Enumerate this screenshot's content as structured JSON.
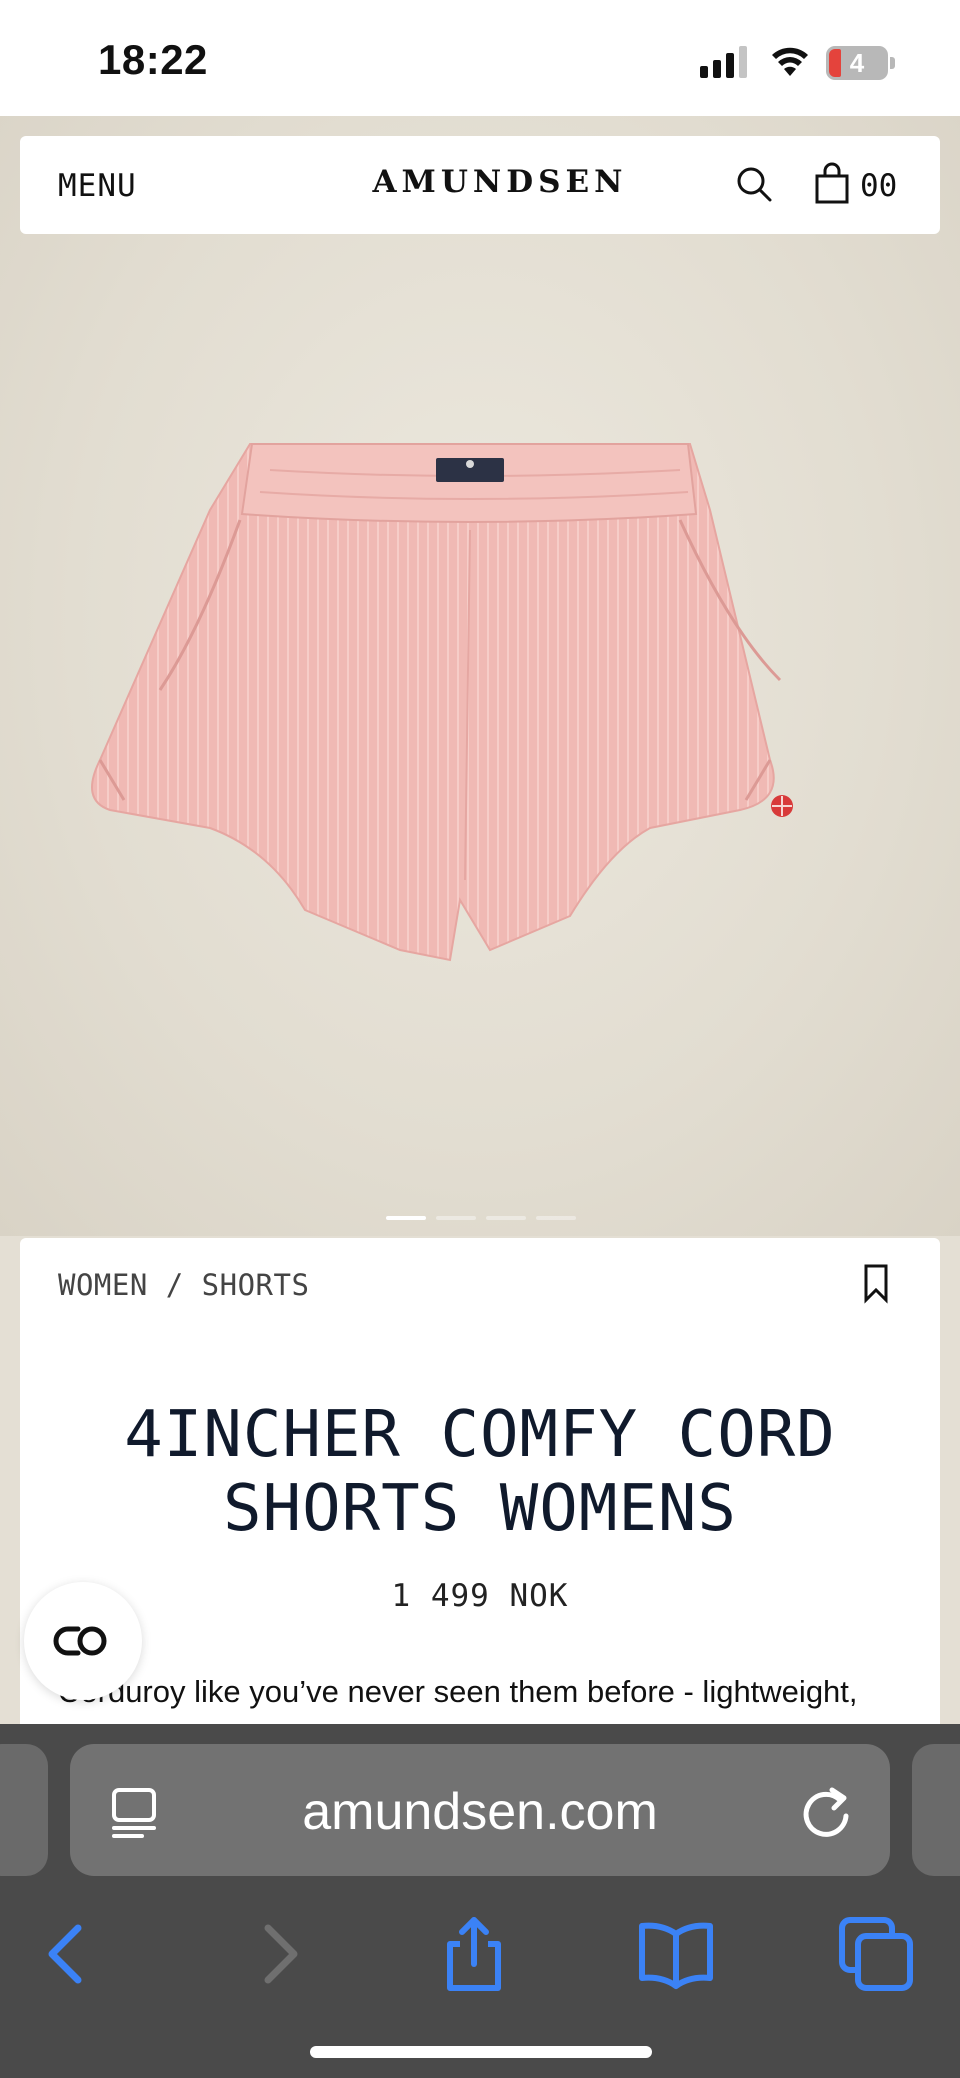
{
  "status_bar": {
    "time": "18:22",
    "battery_level": "4"
  },
  "header": {
    "menu_label": "MENU",
    "logo": "AMUNDSEN",
    "cart_count": "00"
  },
  "product": {
    "breadcrumb": "WOMEN / SHORTS",
    "title_line1": "4INCHER COMFY CORD",
    "title_line2": "SHORTS WOMENS",
    "price": "1 499 NOK",
    "description": "Corduroy like you’ve never seen them before - lightweight,",
    "image_label": "AMUNDSEN",
    "image_count": 4,
    "active_image": 1
  },
  "browser": {
    "url": "amundsen.com"
  },
  "colors": {
    "shorts": "#f0b9b4",
    "background": "#e4dfd4",
    "title": "#101a2c",
    "safari_blue": "#3b82f6"
  }
}
